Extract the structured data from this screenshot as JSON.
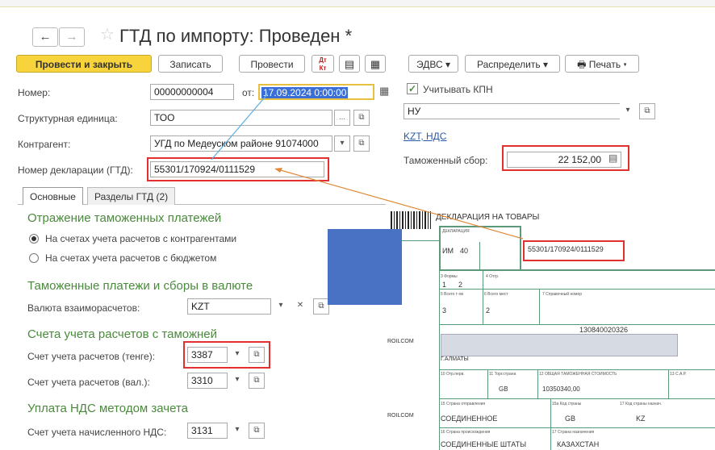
{
  "window": {
    "title": "ГТД по импорту: Проведен *"
  },
  "toolbar": {
    "post_close": "Провести и закрыть",
    "write": "Записать",
    "post": "Провести",
    "edvs": "ЭДВС",
    "distribute": "Распределить",
    "print": "Печать"
  },
  "form": {
    "number_label": "Номер:",
    "number_value": "00000000004",
    "date_label": "от:",
    "date_value": "17.09.2024  0:00:00",
    "kpn_label": "Учитывать КПН",
    "unit_label": "Структурная единица:",
    "unit_value": "ТОО",
    "nu_value": "НУ",
    "contractor_label": "Контрагент:",
    "contractor_value": "УГД по Медеуском районе 91074000",
    "currency_link": "KZT, НДС",
    "decl_label": "Номер декларации (ГТД):",
    "decl_value": "55301/170924/0111529",
    "fee_label": "Таможенный сбор:",
    "fee_value": "22 152,00"
  },
  "tabs": [
    {
      "label": "Основные"
    },
    {
      "label": "Разделы ГТД (2)"
    }
  ],
  "sections": {
    "reflection_title": "Отражение таможенных платежей",
    "radio1": "На счетах учета расчетов с контрагентами",
    "radio2": "На счетах учета расчетов с бюджетом",
    "currency_title": "Таможенные платежи и сборы в валюте",
    "currency_label": "Валюта взаиморасчетов:",
    "currency_value": "KZT",
    "accounts_title": "Счета учета расчетов с таможней",
    "acc_tenge_label": "Счет учета расчетов (тенге):",
    "acc_tenge_value": "3387",
    "acc_val_label": "Счет учета расчетов (вал.):",
    "acc_val_value": "3310",
    "vat_title": "Уплата НДС методом зачета",
    "vat_label": "Счет учета начисленного НДС:",
    "vat_value": "3131"
  },
  "declaration": {
    "header": "ДЕКЛАРАЦИЯ НА ТОВАРЫ",
    "sub": "1 ДЕКЛАРАЦИЯ",
    "im": "ИМ",
    "im_code": "40",
    "number": "55301/170924/0111529",
    "forms_1": "1",
    "forms_2": "2",
    "items": "3",
    "places": "2",
    "reg_no": "130840020326",
    "company_left": "ROILCOM",
    "almaty": "Г.АЛМАТЫ",
    "trade_country": "GB",
    "customs_value": "10350340,00",
    "company_left2": "ROILCOM",
    "dispatch_country": "СОЕДИНЕННОЕ",
    "code_gb": "GB",
    "code_kz": "KZ",
    "origin_country": "СОЕДИНЕННЫЕ ШТАТЫ",
    "dest_country": "КАЗАХСТАН"
  },
  "colors": {
    "accent": "#f7d33c",
    "green": "#4a8a3c",
    "red": "#e03030",
    "blue_block": "#4a72c4"
  }
}
